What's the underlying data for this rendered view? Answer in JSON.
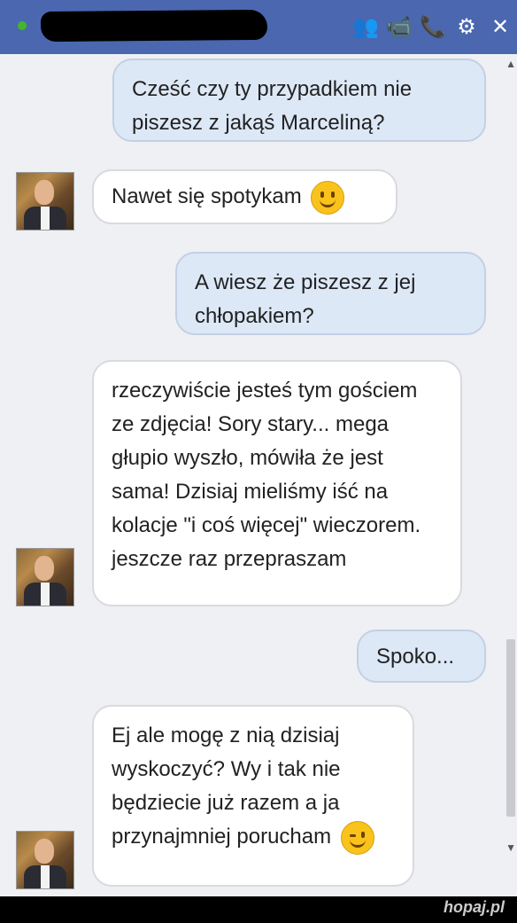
{
  "header": {
    "contact_name": "",
    "icons": [
      "add-friend-icon",
      "video-call-icon",
      "phone-icon",
      "gear-icon",
      "close-icon"
    ],
    "icon_glyphs": [
      "👥",
      "📹",
      "📞",
      "⚙",
      "✕"
    ]
  },
  "messages": [
    {
      "from": "me",
      "text": "Cześć czy ty przypadkiem nie piszesz z jakąś Marceliną?"
    },
    {
      "from": "them",
      "text": "Nawet się spotykam",
      "emoji": "smile-icon"
    },
    {
      "from": "me",
      "text": "A wiesz że piszesz z jej chłopakiem?"
    },
    {
      "from": "them",
      "text": "rzeczywiście jesteś tym gościem ze zdjęcia! Sory stary... mega głupio wyszło, mówiła że jest sama! Dzisiaj mieliśmy iść na kolacje \"i coś więcej\" wieczorem. jeszcze raz przepraszam"
    },
    {
      "from": "me",
      "text": "Spoko..."
    },
    {
      "from": "them",
      "text": "Ej ale mogę z nią dzisiaj wyskoczyć? Wy i tak nie będziecie już razem a ja przynajmniej porucham",
      "emoji": "wink-icon"
    }
  ],
  "watermark": {
    "name": "hopaj",
    "tld": ".pl"
  },
  "colors": {
    "header": "#4a67b0",
    "outgoing_bubble": "#dde8f7",
    "incoming_bubble": "#ffffff",
    "online": "#42b72a"
  }
}
